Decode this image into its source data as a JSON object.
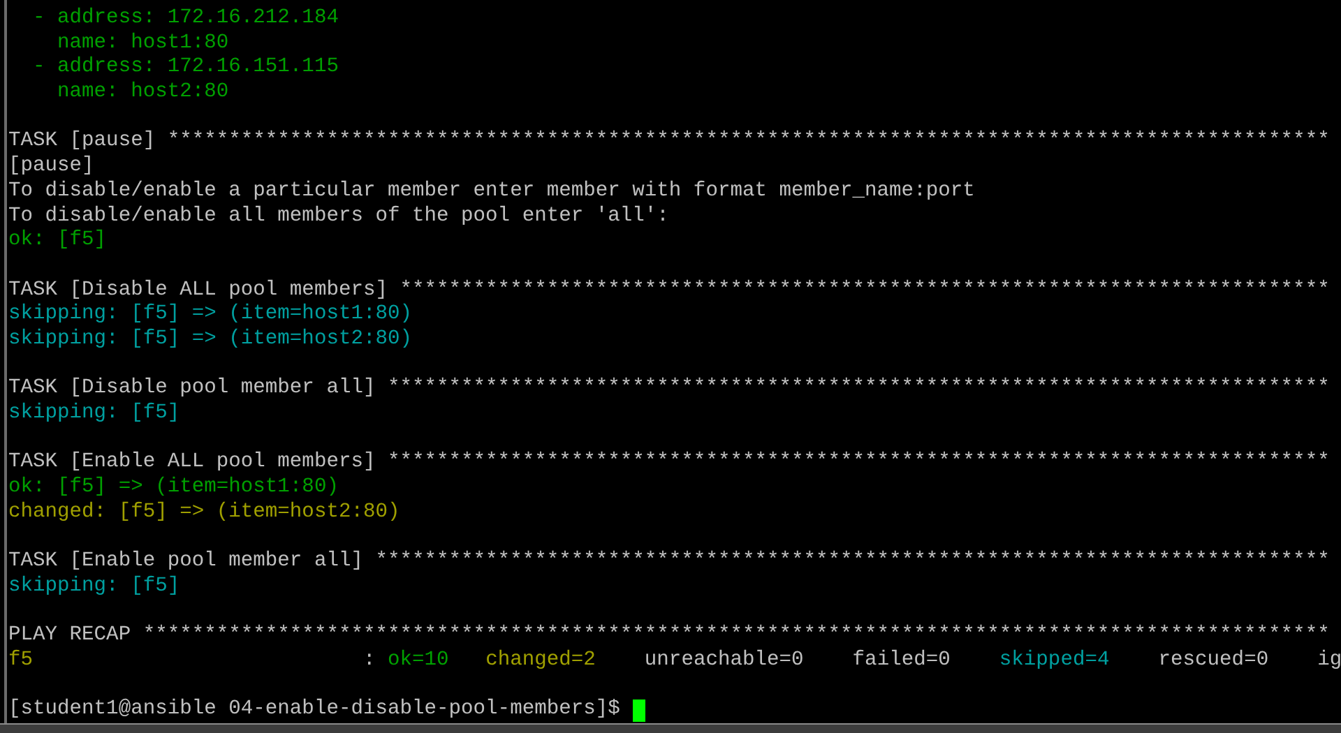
{
  "terminal": {
    "lines": [
      {
        "kind": "text",
        "segments": [
          {
            "text": "  - address: 172.16.212.184",
            "color": "#00a000"
          }
        ]
      },
      {
        "kind": "text",
        "segments": [
          {
            "text": "    name: host1:80",
            "color": "#00a000"
          }
        ]
      },
      {
        "kind": "text",
        "segments": [
          {
            "text": "  - address: 172.16.151.115",
            "color": "#00a000"
          }
        ]
      },
      {
        "kind": "text",
        "segments": [
          {
            "text": "    name: host2:80",
            "color": "#00a000"
          }
        ]
      },
      {
        "kind": "blank"
      },
      {
        "kind": "text",
        "segments": [
          {
            "text": "TASK [pause] ***********************************************************************************************",
            "color": "#c0c0c0"
          }
        ]
      },
      {
        "kind": "text",
        "segments": [
          {
            "text": "[pause]",
            "color": "#c0c0c0"
          }
        ]
      },
      {
        "kind": "text",
        "segments": [
          {
            "text": "To disable/enable a particular member enter member with format member_name:port",
            "color": "#c0c0c0"
          }
        ]
      },
      {
        "kind": "text",
        "segments": [
          {
            "text": "To disable/enable all members of the pool enter 'all':",
            "color": "#c0c0c0"
          }
        ]
      },
      {
        "kind": "text",
        "segments": [
          {
            "text": "ok: [f5]",
            "color": "#00a000"
          }
        ]
      },
      {
        "kind": "blank"
      },
      {
        "kind": "text",
        "segments": [
          {
            "text": "TASK [Disable ALL pool members] ****************************************************************************",
            "color": "#c0c0c0"
          }
        ]
      },
      {
        "kind": "text",
        "segments": [
          {
            "text": "skipping: [f5] => (item=host1:80)",
            "color": "#00a0a0"
          }
        ]
      },
      {
        "kind": "text",
        "segments": [
          {
            "text": "skipping: [f5] => (item=host2:80)",
            "color": "#00a0a0"
          }
        ]
      },
      {
        "kind": "blank"
      },
      {
        "kind": "text",
        "segments": [
          {
            "text": "TASK [Disable pool member all] *****************************************************************************",
            "color": "#c0c0c0"
          }
        ]
      },
      {
        "kind": "text",
        "segments": [
          {
            "text": "skipping: [f5]",
            "color": "#00a0a0"
          }
        ]
      },
      {
        "kind": "blank"
      },
      {
        "kind": "text",
        "segments": [
          {
            "text": "TASK [Enable ALL pool members] *****************************************************************************",
            "color": "#c0c0c0"
          }
        ]
      },
      {
        "kind": "text",
        "segments": [
          {
            "text": "ok: [f5] => (item=host1:80)",
            "color": "#00a000"
          }
        ]
      },
      {
        "kind": "text",
        "segments": [
          {
            "text": "changed: [f5] => (item=host2:80)",
            "color": "#a0a000"
          }
        ]
      },
      {
        "kind": "blank"
      },
      {
        "kind": "text",
        "segments": [
          {
            "text": "TASK [Enable pool member all] ******************************************************************************",
            "color": "#c0c0c0"
          }
        ]
      },
      {
        "kind": "text",
        "segments": [
          {
            "text": "skipping: [f5]",
            "color": "#00a0a0"
          }
        ]
      },
      {
        "kind": "blank"
      },
      {
        "kind": "text",
        "segments": [
          {
            "text": "PLAY RECAP *************************************************************************************************",
            "color": "#c0c0c0"
          }
        ]
      },
      {
        "kind": "text",
        "segments": [
          {
            "text": "f5",
            "color": "#a0a000"
          },
          {
            "text": "                           : ",
            "color": "#c0c0c0"
          },
          {
            "text": "ok=10   ",
            "color": "#00a000"
          },
          {
            "text": "changed=2",
            "color": "#a0a000"
          },
          {
            "text": "    unreachable=0    failed=0    ",
            "color": "#c0c0c0"
          },
          {
            "text": "skipped=4",
            "color": "#00a0a0"
          },
          {
            "text": "    rescued=0    ig",
            "color": "#c0c0c0"
          }
        ]
      },
      {
        "kind": "blank"
      },
      {
        "kind": "prompt",
        "segments": [
          {
            "text": "[student1@ansible 04-enable-disable-pool-members]$ ",
            "color": "#c0c0c0"
          }
        ]
      }
    ]
  }
}
